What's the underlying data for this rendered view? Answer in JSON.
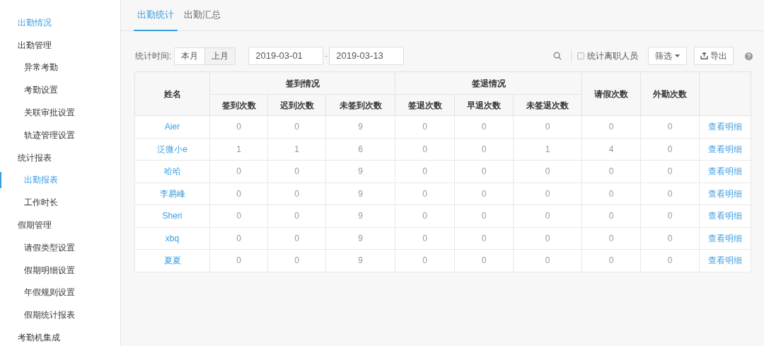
{
  "sidebar": {
    "items": [
      {
        "kind": "section",
        "label": "出勤情况",
        "selected": true
      },
      {
        "kind": "section",
        "label": "出勤管理",
        "selected": false
      },
      {
        "kind": "item",
        "label": "异常考勤",
        "selected": false
      },
      {
        "kind": "item",
        "label": "考勤设置",
        "selected": false
      },
      {
        "kind": "item",
        "label": "关联审批设置",
        "selected": false
      },
      {
        "kind": "item",
        "label": "轨迹管理设置",
        "selected": false
      },
      {
        "kind": "section",
        "label": "统计报表",
        "selected": false
      },
      {
        "kind": "item",
        "label": "出勤报表",
        "selected": true
      },
      {
        "kind": "item",
        "label": "工作时长",
        "selected": false
      },
      {
        "kind": "section",
        "label": "假期管理",
        "selected": false
      },
      {
        "kind": "item",
        "label": "请假类型设置",
        "selected": false
      },
      {
        "kind": "item",
        "label": "假期明细设置",
        "selected": false
      },
      {
        "kind": "item",
        "label": "年假规则设置",
        "selected": false
      },
      {
        "kind": "item",
        "label": "假期统计报表",
        "selected": false
      },
      {
        "kind": "section",
        "label": "考勤机集成",
        "selected": false
      }
    ]
  },
  "tabs": [
    {
      "label": "出勤统计",
      "selected": true
    },
    {
      "label": "出勤汇总",
      "selected": false
    }
  ],
  "toolbar": {
    "period_label": "统计时间:",
    "period_buttons": [
      {
        "label": "本月",
        "selected": true
      },
      {
        "label": "上月",
        "selected": false
      }
    ],
    "date_start": "2019-03-01",
    "date_separator": "-",
    "date_end": "2019-03-13",
    "include_resigned": {
      "label": "统计离职人员",
      "checked": false
    },
    "filter_button": "筛选",
    "export_button": "导出"
  },
  "table": {
    "name_column": "姓名",
    "groups": [
      {
        "label": "签到情况",
        "columns": [
          "签到次数",
          "迟到次数",
          "未签到次数"
        ]
      },
      {
        "label": "签退情况",
        "columns": [
          "签退次数",
          "早退次数",
          "未签退次数"
        ]
      }
    ],
    "single_columns": [
      "请假次数",
      "外勤次数"
    ],
    "rows": [
      {
        "name": "Aier",
        "values": [
          "0",
          "0",
          "9",
          "0",
          "0",
          "0",
          "0",
          "0"
        ],
        "action": "查看明细"
      },
      {
        "name": "泛微小e",
        "values": [
          "1",
          "1",
          "6",
          "0",
          "0",
          "1",
          "4",
          "0"
        ],
        "action": "查看明细"
      },
      {
        "name": "哈哈",
        "values": [
          "0",
          "0",
          "9",
          "0",
          "0",
          "0",
          "0",
          "0"
        ],
        "action": "查看明细"
      },
      {
        "name": "李易峰",
        "values": [
          "0",
          "0",
          "9",
          "0",
          "0",
          "0",
          "0",
          "0"
        ],
        "action": "查看明细"
      },
      {
        "name": "Sheri",
        "values": [
          "0",
          "0",
          "9",
          "0",
          "0",
          "0",
          "0",
          "0"
        ],
        "action": "查看明细"
      },
      {
        "name": "xbq",
        "values": [
          "0",
          "0",
          "9",
          "0",
          "0",
          "0",
          "0",
          "0"
        ],
        "action": "查看明细"
      },
      {
        "name": "夏夏",
        "values": [
          "0",
          "0",
          "9",
          "0",
          "0",
          "0",
          "0",
          "0"
        ],
        "action": "查看明细"
      }
    ]
  }
}
